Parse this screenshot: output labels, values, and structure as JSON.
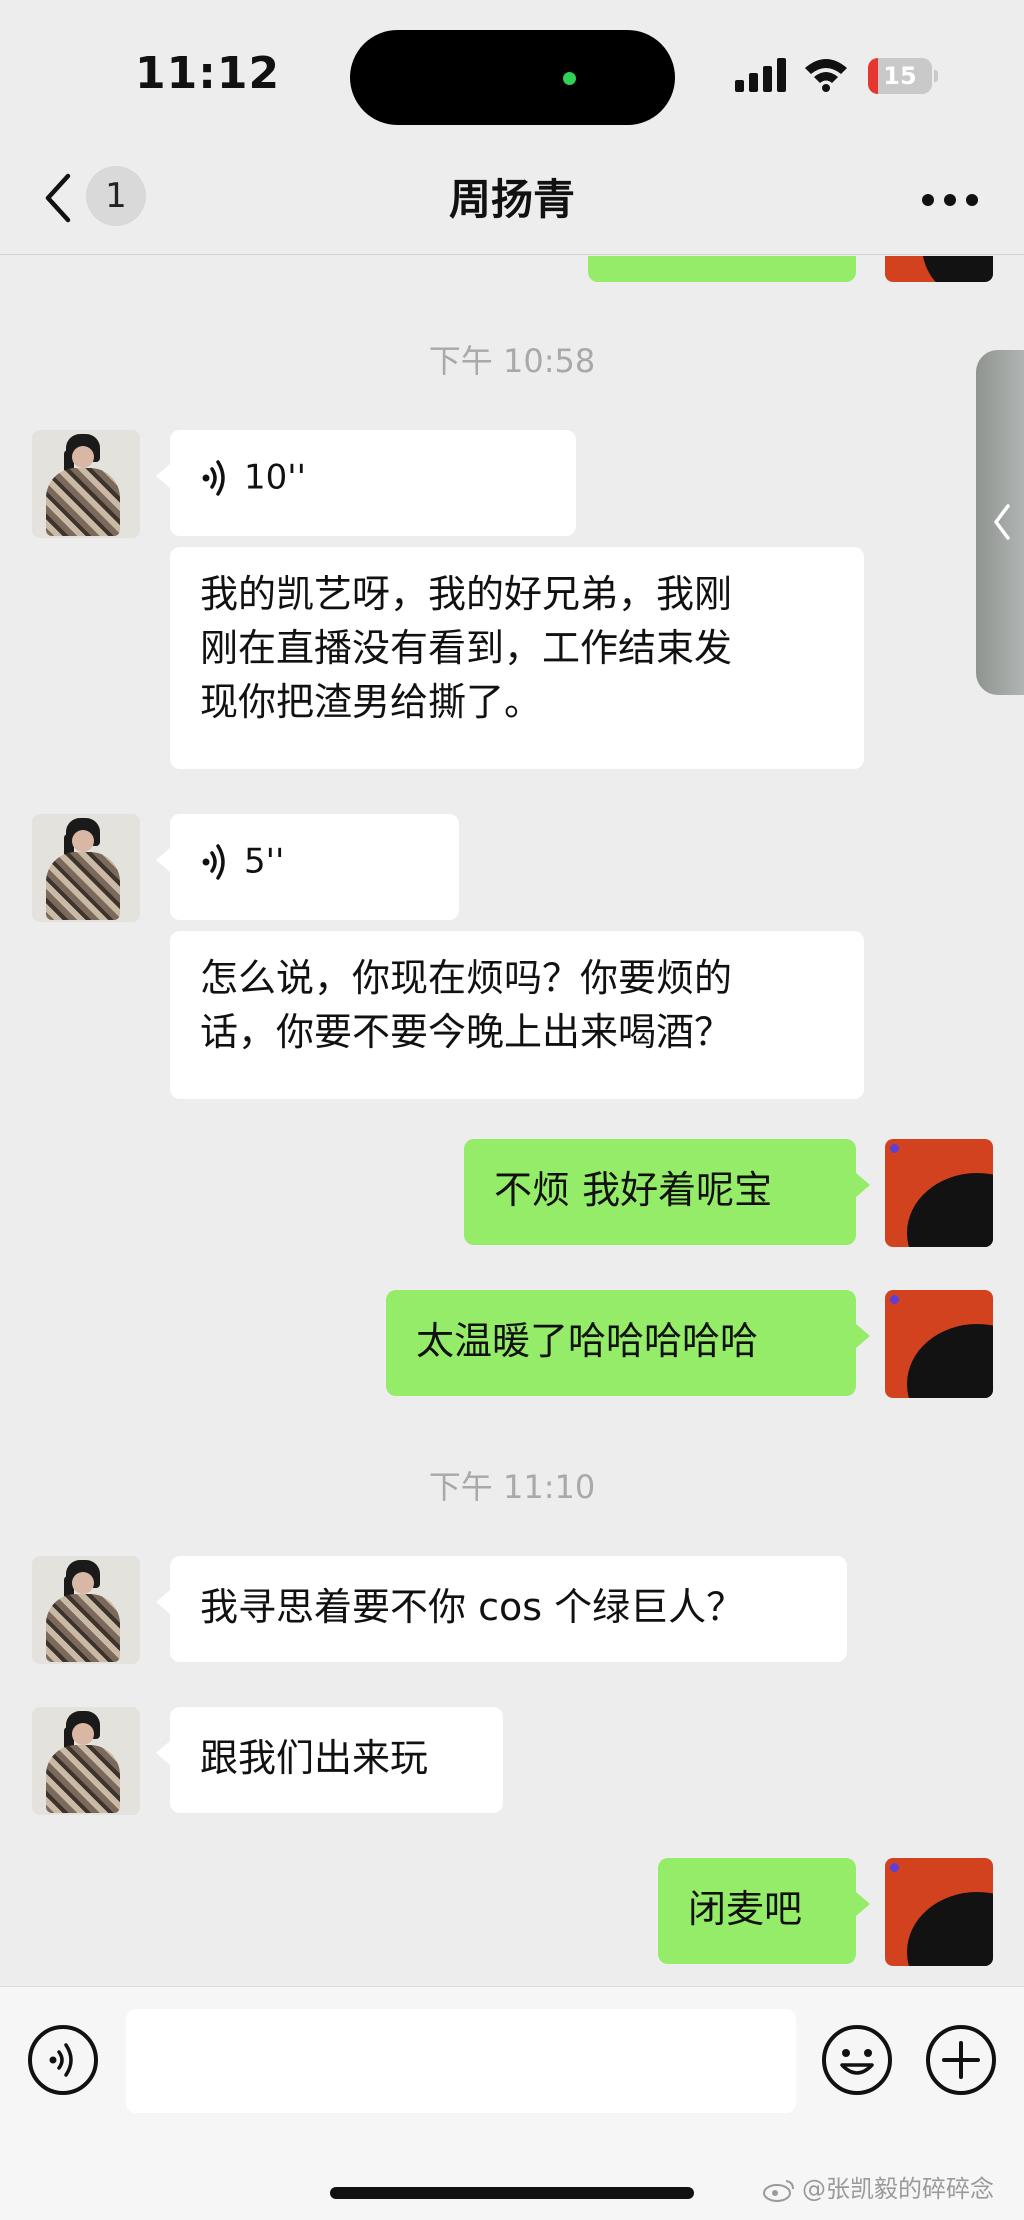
{
  "status_bar": {
    "time": "11:12",
    "battery_level": "15",
    "battery_fraction": 0.15
  },
  "nav": {
    "back_badge": "1",
    "title": "周扬青"
  },
  "messages": [
    {
      "type": "timestamp",
      "text": "下午 10:58"
    },
    {
      "type": "voice",
      "side": "left",
      "duration": "10''"
    },
    {
      "type": "text",
      "side": "left",
      "lines": [
        "我的凯艺呀，我的好兄弟，我刚",
        "刚在直播没有看到，工作结束发",
        "现你把渣男给撕了。"
      ]
    },
    {
      "type": "voice",
      "side": "left",
      "duration": "5''"
    },
    {
      "type": "text",
      "side": "left",
      "lines": [
        "怎么说，你现在烦吗？你要烦的",
        "话，你要不要今晚上出来喝酒？"
      ]
    },
    {
      "type": "text",
      "side": "right",
      "text": "不烦 我好着呢宝"
    },
    {
      "type": "text",
      "side": "right",
      "text": "太温暖了哈哈哈哈哈"
    },
    {
      "type": "timestamp",
      "text": "下午 11:10"
    },
    {
      "type": "text",
      "side": "left",
      "text": "我寻思着要不你 cos 个绿巨人？"
    },
    {
      "type": "text",
      "side": "left",
      "text": "跟我们出来玩"
    },
    {
      "type": "text",
      "side": "right",
      "text": "闭麦吧"
    }
  ],
  "input_bar": {
    "text_value": ""
  },
  "watermark": "@张凯毅的碎碎念",
  "colors": {
    "background": "#ededed",
    "outgoing_bubble": "#95ec69",
    "incoming_bubble": "#ffffff"
  }
}
